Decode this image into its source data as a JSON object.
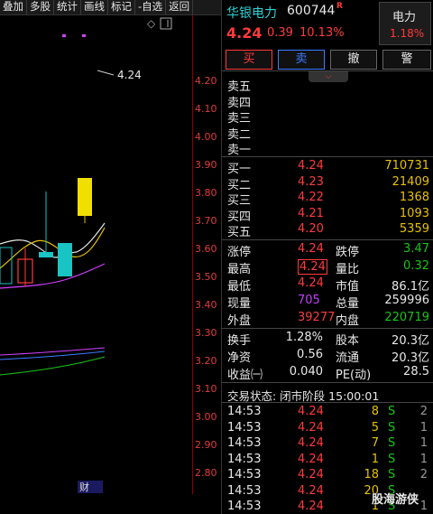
{
  "toolbar": {
    "items": [
      "叠加",
      "多股",
      "统计",
      "画线",
      "标记",
      "-自选",
      "返回"
    ]
  },
  "chart": {
    "price_ticks": [
      "4.20",
      "4.10",
      "4.00",
      "3.90",
      "3.80",
      "3.70",
      "3.60",
      "3.50",
      "3.40",
      "3.30",
      "3.20",
      "3.10",
      "3.00",
      "2.90",
      "2.80"
    ],
    "high_marker": "4.24",
    "finance_label": "财"
  },
  "stock": {
    "name": "华银电力",
    "code": "600744",
    "flag": "R",
    "price": "4.24",
    "change": "0.39",
    "change_pct": "10.13%",
    "sector_name": "电力",
    "sector_pct": "1.18%"
  },
  "buttons": {
    "buy": "买",
    "sell": "卖",
    "cancel": "撤",
    "alert": "警"
  },
  "asks": [
    {
      "label": "卖五",
      "price": "",
      "vol": ""
    },
    {
      "label": "卖四",
      "price": "",
      "vol": ""
    },
    {
      "label": "卖三",
      "price": "",
      "vol": ""
    },
    {
      "label": "卖二",
      "price": "",
      "vol": ""
    },
    {
      "label": "卖一",
      "price": "",
      "vol": ""
    }
  ],
  "bids": [
    {
      "label": "买一",
      "price": "4.24",
      "vol": "710731"
    },
    {
      "label": "买二",
      "price": "4.23",
      "vol": "21409"
    },
    {
      "label": "买三",
      "price": "4.22",
      "vol": "1368"
    },
    {
      "label": "买四",
      "price": "4.21",
      "vol": "1093"
    },
    {
      "label": "买五",
      "price": "4.20",
      "vol": "5359"
    }
  ],
  "stats": [
    {
      "l1": "涨停",
      "v1": "4.24",
      "c1": "red",
      "l2": "跌停",
      "v2": "3.47",
      "c2": "green"
    },
    {
      "l1": "最高",
      "v1": "4.24",
      "c1": "red",
      "l2": "量比",
      "v2": "0.32",
      "c2": "green"
    },
    {
      "l1": "最低",
      "v1": "4.24",
      "c1": "red",
      "l2": "市值",
      "v2": "86.1亿",
      "c2": "white"
    },
    {
      "l1": "现量",
      "v1": "705",
      "c1": "purple",
      "l2": "总量",
      "v2": "259996",
      "c2": "white"
    },
    {
      "l1": "外盘",
      "v1": "39277",
      "c1": "red",
      "l2": "内盘",
      "v2": "220719",
      "c2": "green"
    }
  ],
  "stats2": [
    {
      "l1": "换手",
      "v1": "1.28%",
      "l2": "股本",
      "v2": "20.3亿"
    },
    {
      "l1": "净资",
      "v1": "0.56",
      "l2": "流通",
      "v2": "20.3亿"
    },
    {
      "l1": "收益㈠",
      "v1": "0.040",
      "l2": "PE(动)",
      "v2": "28.5"
    }
  ],
  "trade_status": "交易状态: 闭市阶段 15:00:01",
  "ticks": [
    {
      "time": "14:53",
      "price": "4.24",
      "vol": "8",
      "side": "S",
      "n": "2"
    },
    {
      "time": "14:53",
      "price": "4.24",
      "vol": "5",
      "side": "S",
      "n": "1"
    },
    {
      "time": "14:53",
      "price": "4.24",
      "vol": "7",
      "side": "S",
      "n": "1"
    },
    {
      "time": "14:53",
      "price": "4.24",
      "vol": "1",
      "side": "S",
      "n": "1"
    },
    {
      "time": "14:53",
      "price": "4.24",
      "vol": "18",
      "side": "S",
      "n": "2"
    },
    {
      "time": "14:53",
      "price": "4.24",
      "vol": "20",
      "side": "S",
      "n": ""
    },
    {
      "time": "14:53",
      "price": "4.24",
      "vol": "1",
      "side": "S",
      "n": "1"
    }
  ],
  "watermark": "股海游侠"
}
